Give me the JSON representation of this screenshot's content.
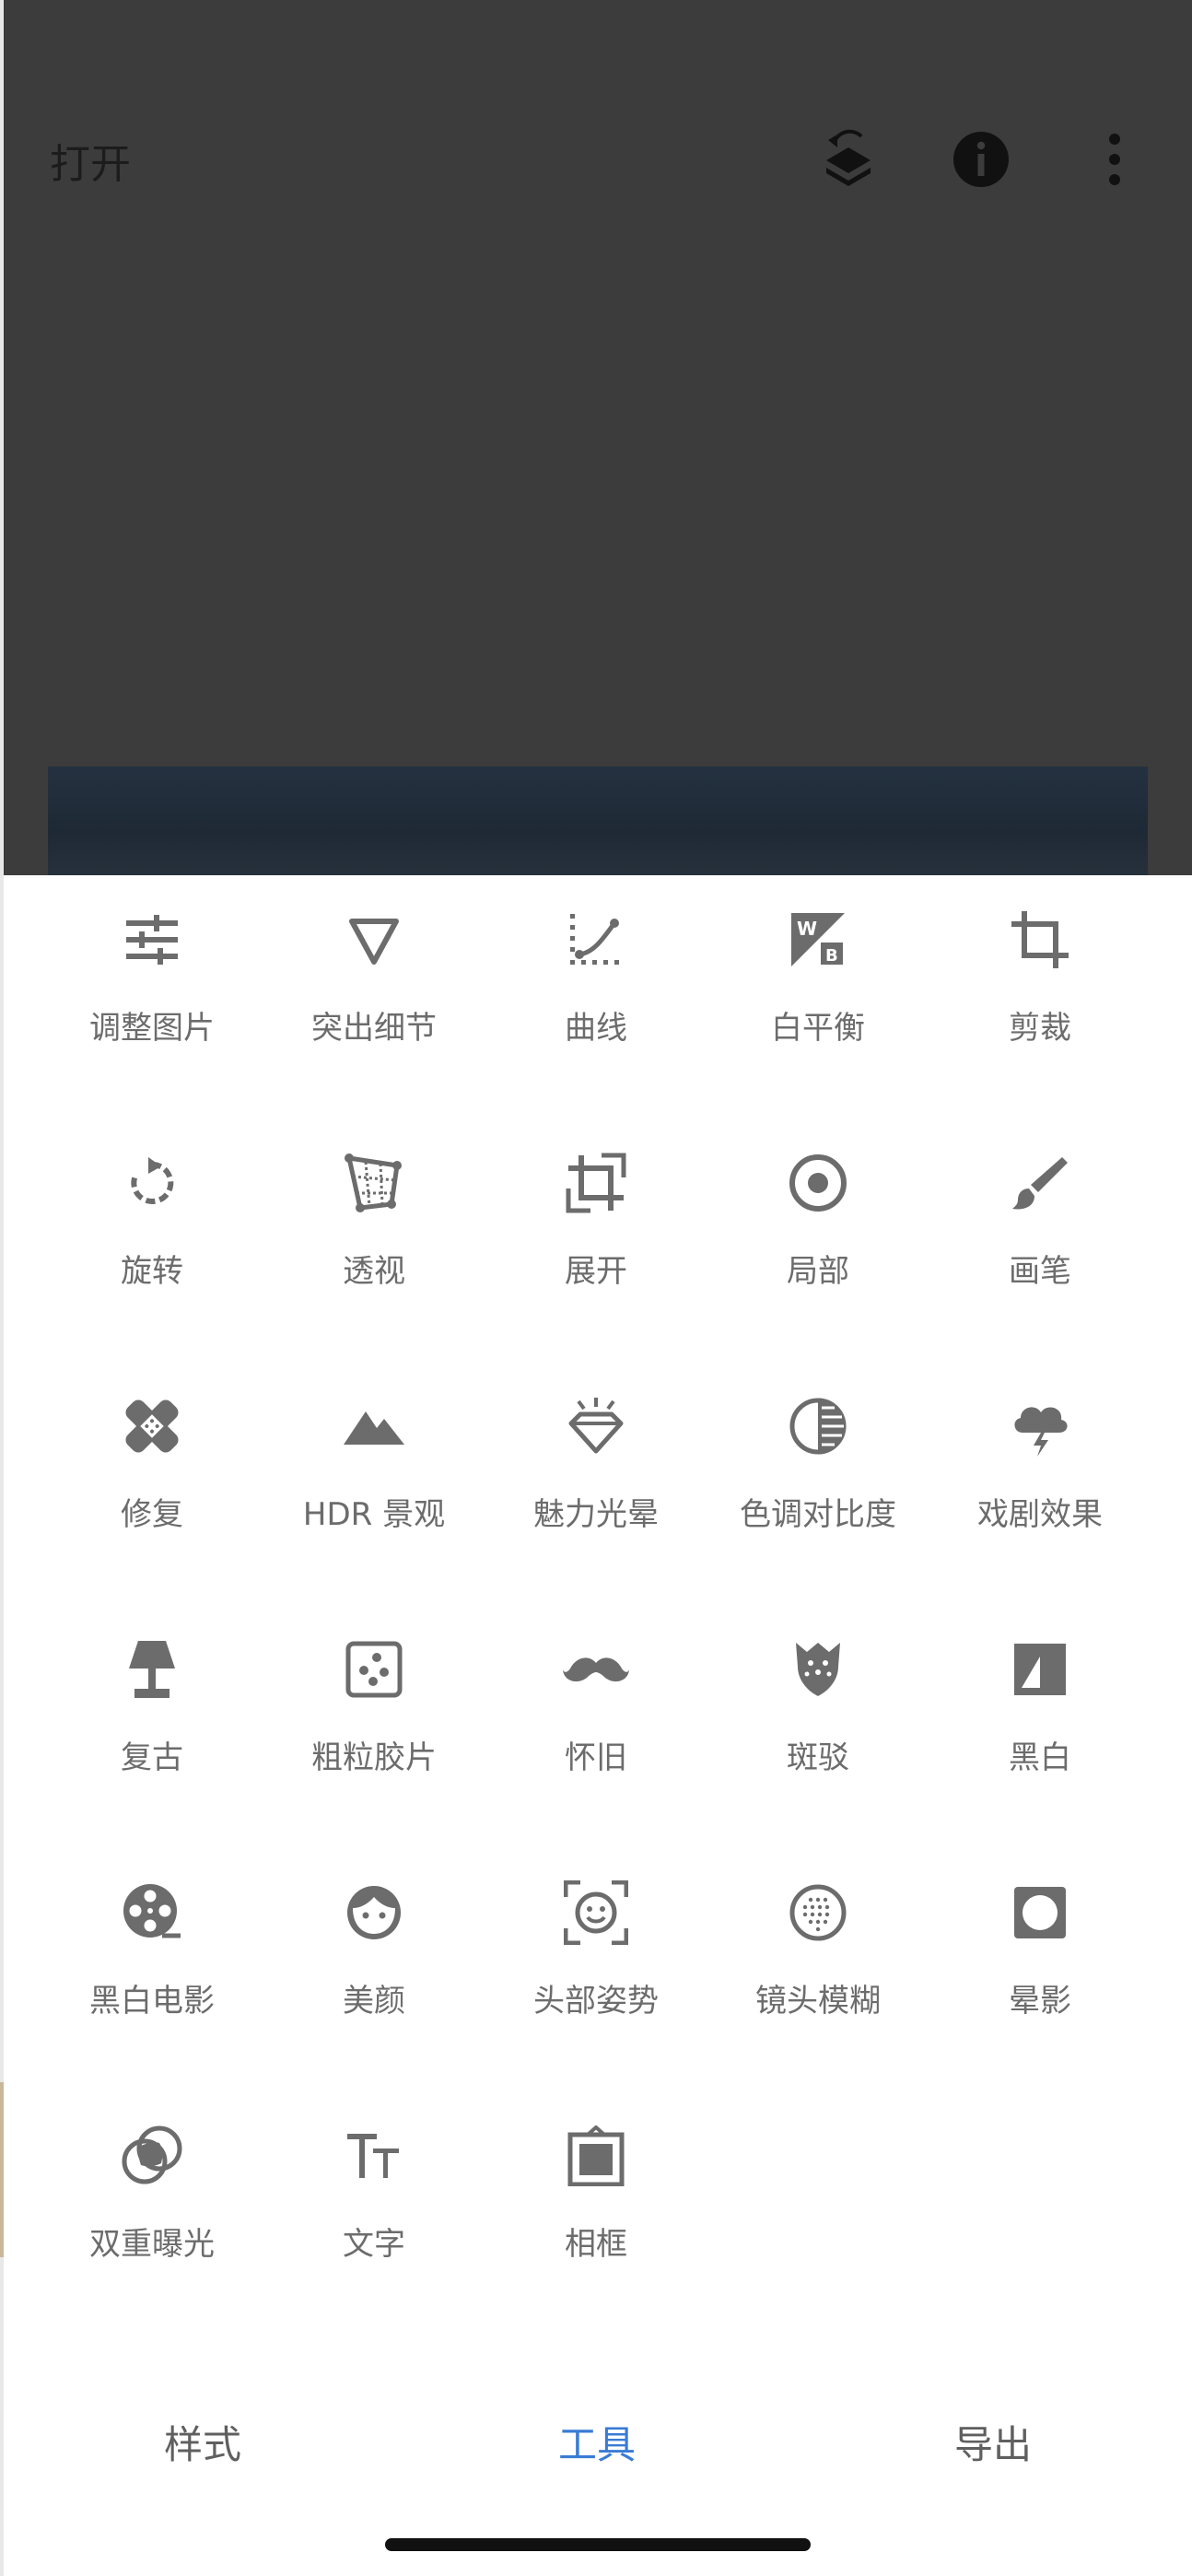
{
  "header": {
    "open_label": "打开"
  },
  "icons": {
    "layers": "layers-undo-icon",
    "info": "info-icon",
    "more": "more-vertical-icon"
  },
  "colors": {
    "accent": "#3a7bd5",
    "icon": "#6c6c6c",
    "backdrop": "#3c3c3c"
  },
  "tools": [
    {
      "label": "调整图片",
      "icon": "tune-sliders-icon"
    },
    {
      "label": "突出细节",
      "icon": "details-triangle-icon"
    },
    {
      "label": "曲线",
      "icon": "curves-icon"
    },
    {
      "label": "白平衡",
      "icon": "white-balance-icon"
    },
    {
      "label": "剪裁",
      "icon": "crop-icon"
    },
    {
      "label": "旋转",
      "icon": "rotate-icon"
    },
    {
      "label": "透视",
      "icon": "perspective-icon"
    },
    {
      "label": "展开",
      "icon": "expand-icon"
    },
    {
      "label": "局部",
      "icon": "selective-icon"
    },
    {
      "label": "画笔",
      "icon": "brush-icon"
    },
    {
      "label": "修复",
      "icon": "healing-bandage-icon"
    },
    {
      "label": "HDR 景观",
      "icon": "hdr-mountain-icon"
    },
    {
      "label": "魅力光晕",
      "icon": "glamour-glow-icon"
    },
    {
      "label": "色调对比度",
      "icon": "tonal-contrast-icon"
    },
    {
      "label": "戏剧效果",
      "icon": "drama-cloud-icon"
    },
    {
      "label": "复古",
      "icon": "vintage-lamp-icon"
    },
    {
      "label": "粗粒胶片",
      "icon": "grainy-film-icon"
    },
    {
      "label": "怀旧",
      "icon": "retrolux-mustache-icon"
    },
    {
      "label": "斑驳",
      "icon": "grunge-icon"
    },
    {
      "label": "黑白",
      "icon": "black-white-icon"
    },
    {
      "label": "黑白电影",
      "icon": "noir-film-reel-icon"
    },
    {
      "label": "美颜",
      "icon": "face-glamour-icon"
    },
    {
      "label": "头部姿势",
      "icon": "head-pose-icon"
    },
    {
      "label": "镜头模糊",
      "icon": "lens-blur-icon"
    },
    {
      "label": "晕影",
      "icon": "vignette-icon"
    },
    {
      "label": "双重曝光",
      "icon": "double-exposure-icon"
    },
    {
      "label": "文字",
      "icon": "text-icon"
    },
    {
      "label": "相框",
      "icon": "frame-icon"
    }
  ],
  "tabs": [
    {
      "label": "样式",
      "active": false
    },
    {
      "label": "工具",
      "active": true
    },
    {
      "label": "导出",
      "active": false
    }
  ]
}
